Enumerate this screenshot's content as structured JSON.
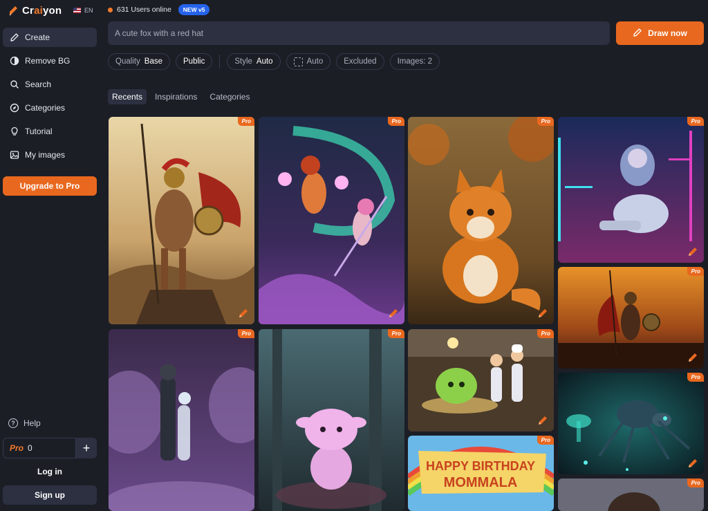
{
  "app": {
    "logo_prefix": "Cr",
    "logo_accent": "ai",
    "logo_suffix": "yon",
    "language": "EN",
    "brand_color": "#e9681f"
  },
  "sidebar": {
    "items": [
      {
        "label": "Create",
        "icon": "pencil-icon"
      },
      {
        "label": "Remove BG",
        "icon": "contrast-icon"
      },
      {
        "label": "Search",
        "icon": "search-icon"
      },
      {
        "label": "Categories",
        "icon": "compass-icon"
      },
      {
        "label": "Tutorial",
        "icon": "lightbulb-icon"
      },
      {
        "label": "My images",
        "icon": "image-icon"
      }
    ],
    "upgrade_label": "Upgrade to Pro",
    "help_label": "Help",
    "pro_label": "Pro",
    "pro_count": "0",
    "plus_label": "+",
    "login_label": "Log in",
    "signup_label": "Sign up"
  },
  "status": {
    "users_online": "631 Users online",
    "new_badge": "NEW v5"
  },
  "prompt": {
    "placeholder": "A cute fox with a red hat",
    "draw_label": "Draw now"
  },
  "filters": {
    "quality_label": "Quality",
    "quality_value": "Base",
    "visibility": "Public",
    "style_label": "Style",
    "style_value": "Auto",
    "aspect_value": "Auto",
    "excluded_label": "Excluded",
    "images_label": "Images: 2"
  },
  "tabs": [
    "Recents",
    "Inspirations",
    "Categories"
  ],
  "gallery": {
    "pro_badge": "Pro"
  }
}
